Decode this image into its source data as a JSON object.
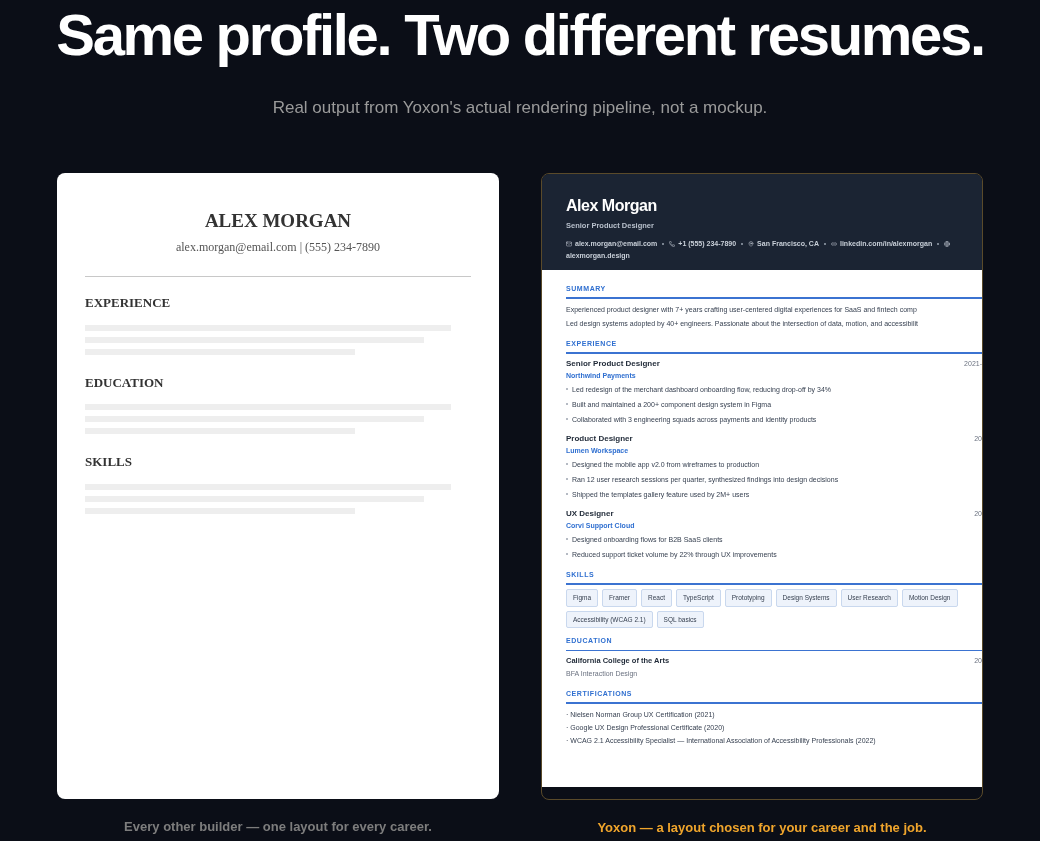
{
  "headline": "Same profile. Two different resumes.",
  "subtitle": "Real output from Yoxon's actual rendering pipeline, not a mockup.",
  "plain_resume": {
    "name": "ALEX MORGAN",
    "contact": "alex.morgan@email.com | (555) 234-7890",
    "sections": [
      {
        "heading": "EXPERIENCE"
      },
      {
        "heading": "EDUCATION"
      },
      {
        "heading": "SKILLS"
      }
    ]
  },
  "plain_caption": "Every other builder — one layout for every career.",
  "yoxon_resume": {
    "name": "Alex Morgan",
    "role": "Senior Product Designer",
    "contacts": [
      {
        "kind": "email",
        "text": "alex.morgan@email.com"
      },
      {
        "kind": "phone",
        "text": "+1 (555) 234-7890"
      },
      {
        "kind": "location",
        "text": "San Francisco, CA"
      },
      {
        "kind": "linkedin",
        "text": "linkedin.com/in/alexmorgan"
      },
      {
        "kind": "website",
        "text": "alexmorgan.design"
      }
    ],
    "sections": [
      {
        "kind": "summary",
        "heading": "SUMMARY",
        "lines": [
          "Experienced product designer with 7+ years crafting user-centered digital experiences for SaaS and fintech comp",
          "Led design systems adopted by 40+ engineers. Passionate about the intersection of data, motion, and accessibilit"
        ]
      },
      {
        "kind": "experience",
        "heading": "EXPERIENCE",
        "jobs": [
          {
            "title": "Senior Product Designer",
            "date": "2021-",
            "company": "Northwind Payments",
            "bullets": [
              "Led redesign of the merchant dashboard onboarding flow, reducing drop-off by 34%",
              "Built and maintained a 200+ component design system in Figma",
              "Collaborated with 3 engineering squads across payments and identity products"
            ]
          },
          {
            "title": "Product Designer",
            "date": "20",
            "company": "Lumen Workspace",
            "bullets": [
              "Designed the mobile app v2.0 from wireframes to production",
              "Ran 12 user research sessions per quarter, synthesized findings into design decisions",
              "Shipped the templates gallery feature used by 2M+ users"
            ]
          },
          {
            "title": "UX Designer",
            "date": "20",
            "company": "Corvi Support Cloud",
            "bullets": [
              "Designed onboarding flows for B2B SaaS clients",
              "Reduced support ticket volume by 22% through UX improvements"
            ]
          }
        ]
      },
      {
        "kind": "skills",
        "heading": "SKILLS",
        "tags": [
          "Figma",
          "Framer",
          "React",
          "TypeScript",
          "Prototyping",
          "Design Systems",
          "User Research",
          "Motion Design",
          "Accessibility (WCAG 2.1)",
          "SQL basics"
        ]
      },
      {
        "kind": "education",
        "heading": "EDUCATION",
        "school": "California College of the Arts",
        "date": "20",
        "degree": "BFA Interaction Design"
      },
      {
        "kind": "certifications",
        "heading": "CERTIFICATIONS",
        "items": [
          "· Nielsen Norman Group UX Certification (2021)",
          "· Google UX Design Professional Certificate (2020)",
          "· WCAG 2.1 Accessibility Specialist — International Association of Accessibility Professionals (2022)"
        ]
      }
    ]
  },
  "yoxon_caption": "Yoxon — a layout chosen for your career and the job."
}
